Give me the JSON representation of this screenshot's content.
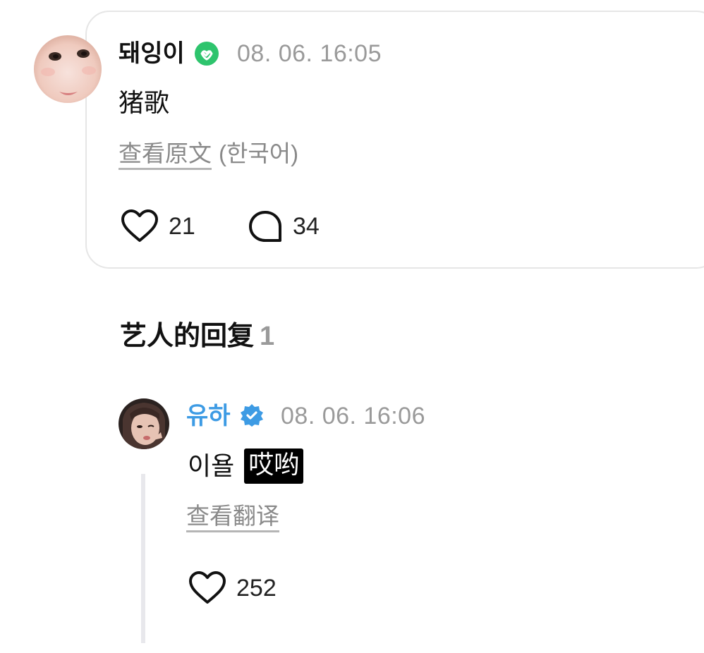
{
  "comment": {
    "username": "돼잉이",
    "timestamp": "08. 06. 16:05",
    "text": "猪歌",
    "view_original": "查看原文",
    "original_language": "(한국어)",
    "likes": "21",
    "replies": "34",
    "badge_color": "#2ec46d"
  },
  "artist_replies": {
    "title": "艺人的回复",
    "count": "1",
    "reply": {
      "username": "유하",
      "timestamp": "08. 06. 16:06",
      "text": "이욜",
      "highlight": "哎哟",
      "view_translation": "查看翻译",
      "likes": "252",
      "name_color": "#3d9be4",
      "badge_color": "#3d9be4"
    }
  },
  "icons": {
    "verified_main": "verified-check-icon",
    "verified_artist": "verified-star-icon",
    "like": "heart-icon",
    "reply": "speech-bubble-icon"
  }
}
